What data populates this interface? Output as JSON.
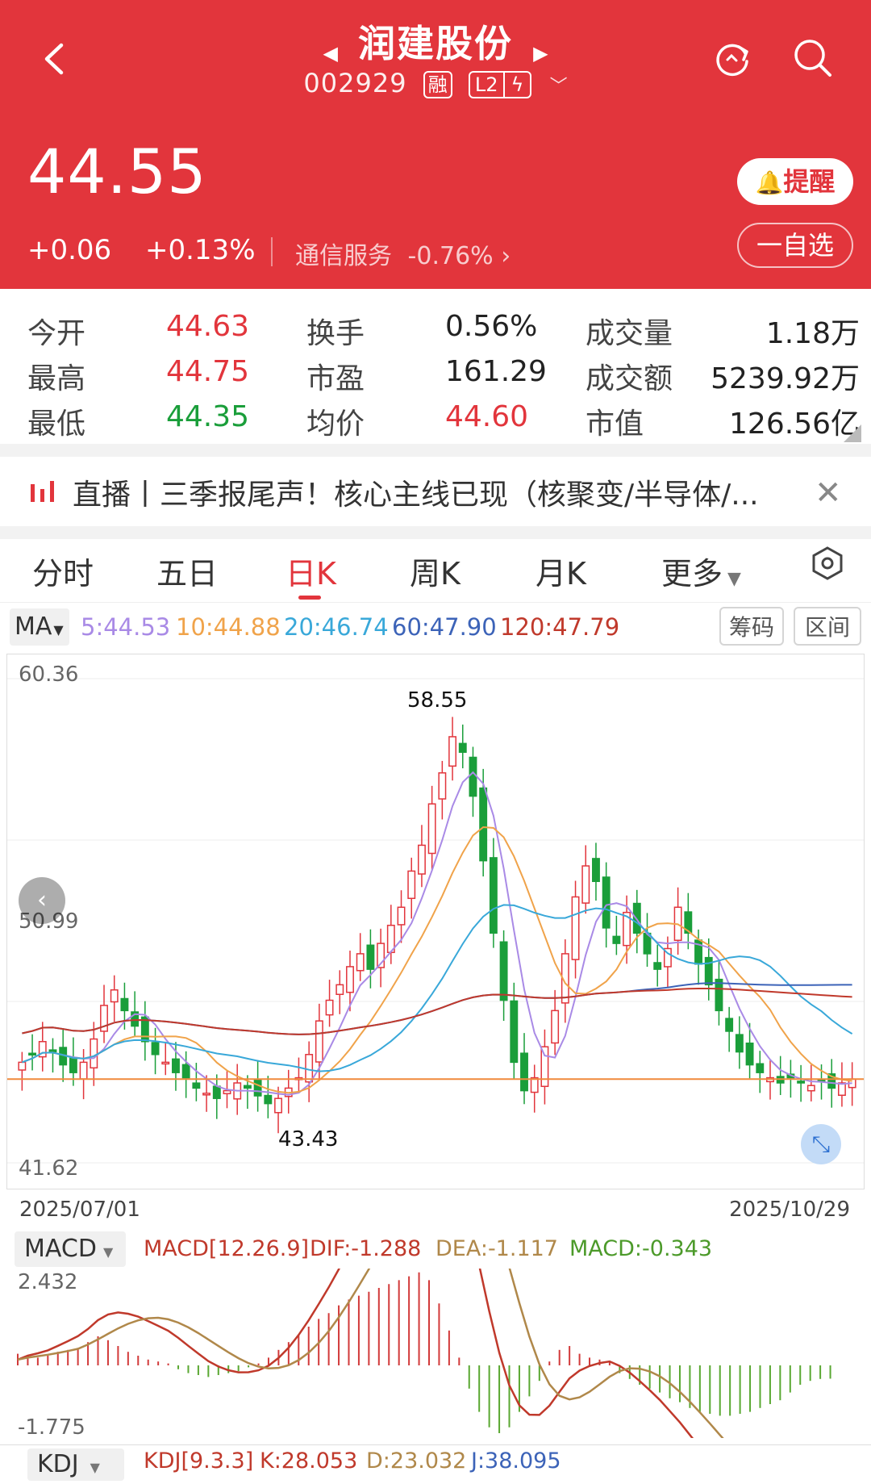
{
  "header": {
    "title": "润建股份",
    "code": "002929",
    "tag_margin": "融",
    "tag_level": "L2",
    "price": "44.55",
    "change_abs": "+0.06",
    "change_pct": "+0.13%",
    "sector_name": "通信服务",
    "sector_pct": "-0.76%",
    "remind_label": "提醒",
    "watch_label": "一自选",
    "colors": {
      "up": "#e2353c",
      "down": "#1a9e3a"
    }
  },
  "stats": {
    "open_label": "今开",
    "open": "44.63",
    "high_label": "最高",
    "high": "44.75",
    "low_label": "最低",
    "low": "44.35",
    "turnover_label": "换手",
    "turnover": "0.56%",
    "pe_label": "市盈",
    "pe": "161.29",
    "avg_label": "均价",
    "avg": "44.60",
    "volume_label": "成交量",
    "volume": "1.18万",
    "amount_label": "成交额",
    "amount": "5239.92万",
    "mktcap_label": "市值",
    "mktcap": "126.56亿"
  },
  "news": {
    "text": "直播丨三季报尾声！核心主线已现（核聚变/半导体/..."
  },
  "tabs": [
    "分时",
    "五日",
    "日K",
    "周K",
    "月K",
    "更多"
  ],
  "active_tab": "日K",
  "ma": {
    "button": "MA",
    "ma5": "5:44.53",
    "ma10": "10:44.88",
    "ma20": "20:46.74",
    "ma60": "60:47.90",
    "ma120": "120:47.79",
    "chip_label": "筹码",
    "range_label": "区间"
  },
  "kline": {
    "y_max": "60.36",
    "y_mid": "50.99",
    "y_min": "41.62",
    "peak_label": "58.55",
    "trough_label": "43.43",
    "date_start": "2025/07/01",
    "date_end": "2025/10/29"
  },
  "macd": {
    "button": "MACD",
    "params": "MACD[12.26.9]",
    "dif": "DIF:-1.288",
    "dea": "DEA:-1.117",
    "macd": "MACD:-0.343",
    "y_max": "2.432",
    "y_min": "-1.775"
  },
  "kdj": {
    "button": "KDJ",
    "params": "KDJ[9.3.3]",
    "k": "K:28.053",
    "d": "D:23.032",
    "j": "J:38.095"
  },
  "chart_data": {
    "type": "candlestick",
    "title": "",
    "x_range": [
      "2025/07/01",
      "2025/10/29"
    ],
    "ylim": [
      41.62,
      60.36
    ],
    "high_marker": 58.55,
    "low_marker": 43.43,
    "close_series": [
      45.2,
      45.5,
      46.0,
      45.6,
      45.1,
      44.8,
      45.2,
      46.1,
      47.4,
      48.0,
      47.2,
      46.6,
      46.0,
      45.5,
      45.2,
      44.8,
      44.6,
      44.2,
      44.0,
      43.8,
      44.1,
      44.4,
      44.2,
      43.9,
      43.6,
      43.8,
      44.2,
      44.6,
      45.5,
      46.8,
      47.6,
      48.2,
      48.9,
      49.4,
      48.8,
      49.8,
      50.5,
      51.2,
      52.6,
      53.6,
      55.2,
      56.4,
      57.8,
      57.2,
      55.5,
      53.0,
      50.2,
      47.6,
      45.2,
      44.1,
      44.6,
      45.8,
      47.2,
      49.4,
      51.6,
      52.8,
      52.2,
      50.4,
      49.8,
      51.0,
      50.2,
      49.4,
      48.8,
      49.6,
      51.2,
      50.2,
      49.0,
      48.2,
      47.2,
      46.4,
      45.6,
      45.1,
      44.8,
      44.6,
      44.4,
      44.6,
      44.4,
      44.3,
      44.5,
      44.2,
      44.4,
      44.55
    ],
    "ma_lines": [
      "MA5",
      "MA10",
      "MA20",
      "MA60",
      "MA120"
    ],
    "macd_hist": [
      0.3,
      0.25,
      0.2,
      0.25,
      0.35,
      0.4,
      0.45,
      0.6,
      0.75,
      0.65,
      0.5,
      0.35,
      0.25,
      0.15,
      0.1,
      0.05,
      -0.1,
      -0.2,
      -0.25,
      -0.3,
      -0.25,
      -0.2,
      -0.15,
      -0.05,
      0.05,
      0.2,
      0.4,
      0.6,
      0.8,
      1.0,
      1.2,
      1.35,
      1.55,
      1.7,
      1.8,
      1.9,
      2.0,
      2.1,
      2.2,
      2.3,
      2.4,
      2.2,
      1.6,
      0.9,
      0.2,
      -0.6,
      -1.2,
      -1.6,
      -1.75,
      -1.6,
      -1.2,
      -0.8,
      -0.4,
      0.1,
      0.4,
      0.5,
      0.3,
      0.2,
      0.15,
      0.1,
      -0.2,
      -0.35,
      -0.5,
      -0.6,
      -0.7,
      -0.85,
      -0.95,
      -1.1,
      -1.2,
      -1.25,
      -1.3,
      -1.3,
      -1.25,
      -1.2,
      -1.1,
      -1.0,
      -0.9,
      -0.7,
      -0.5,
      -0.4,
      -0.35,
      -0.343
    ]
  }
}
